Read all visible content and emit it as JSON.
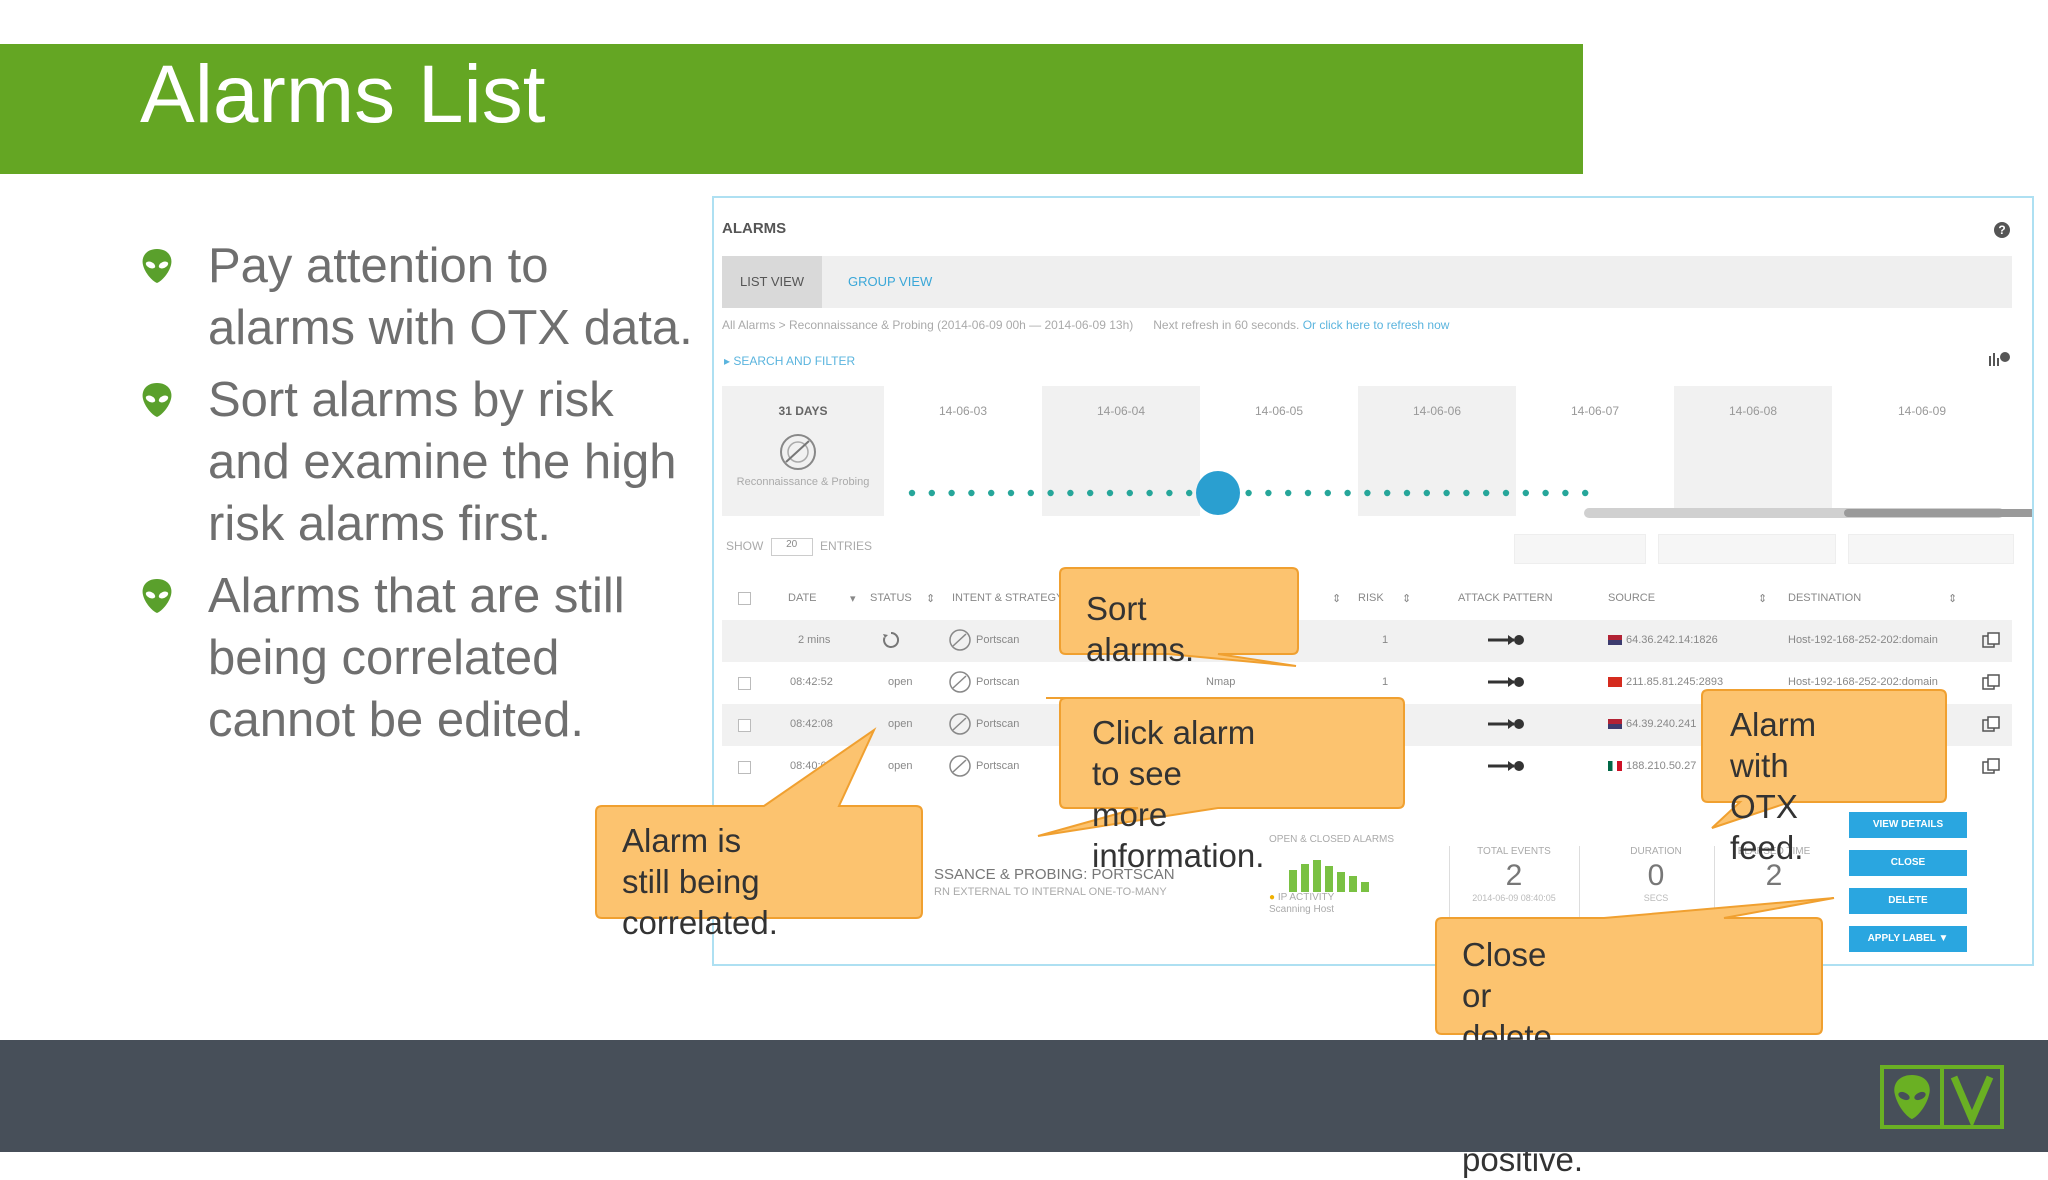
{
  "slide": {
    "title": "Alarms List",
    "bullets": [
      "Pay attention to alarms with OTX data.",
      "Sort alarms by risk and examine the high risk alarms first.",
      "Alarms that are still being correlated cannot be edited."
    ]
  },
  "screenshot": {
    "panel_title": "ALARMS",
    "help_glyph": "?",
    "tabs": [
      "LIST VIEW",
      "GROUP VIEW"
    ],
    "breadcrumb": "All Alarms > Reconnaissance & Probing (2014-06-09 00h — 2014-06-09 13h)",
    "refresh_text": "Next refresh in 60 seconds.",
    "refresh_link": "Or click here to refresh now",
    "search_filter": "▸ SEARCH AND FILTER",
    "timeline": {
      "range_label": "31 DAYS",
      "dates": [
        "14-06-03",
        "14-06-04",
        "14-06-05",
        "14-06-06",
        "14-06-07",
        "14-06-08",
        "14-06-09"
      ],
      "category_label": "Reconnaissance & Probing"
    },
    "show_label": "SHOW",
    "show_value": "20",
    "entries_label": "ENTRIES",
    "columns": [
      "DATE",
      "STATUS",
      "INTENT & STRATEGY",
      "RISK",
      "ATTACK PATTERN",
      "SOURCE",
      "DESTINATION"
    ],
    "rows": [
      {
        "date": "2 mins",
        "status": "",
        "intent": "Portscan",
        "method": "",
        "risk": "1",
        "source": "64.36.242.14:1826",
        "destination": "Host-192-168-252-202:domain"
      },
      {
        "date": "08:42:52",
        "status": "open",
        "intent": "Portscan",
        "method": "Nmap",
        "risk": "1",
        "source": "211.85.81.245:2893",
        "destination": "Host-192-168-252-202:domain"
      },
      {
        "date": "08:42:08",
        "status": "open",
        "intent": "Portscan",
        "method": "",
        "risk": "",
        "source": "64.39.240.241",
        "destination": ""
      },
      {
        "date": "08:40:0",
        "status": "open",
        "intent": "Portscan",
        "method": "",
        "risk": "",
        "source": "188.210.50.27",
        "destination": ""
      }
    ],
    "detail": {
      "title": "SSANCE & PROBING: PORTSCAN",
      "subtitle": "RN  EXTERNAL TO INTERNAL ONE-TO-MANY",
      "open_closed_label": "OPEN & CLOSED ALARMS",
      "ip_activity_label": "IP ACTIVITY",
      "ip_activity_value": "Scanning Host",
      "stats": [
        {
          "label": "TOTAL EVENTS",
          "value": "2",
          "sub": "2014-06-09 08:40:05"
        },
        {
          "label": "DURATION",
          "value": "0",
          "sub": "SECS"
        },
        {
          "label": "ELAPSED TIME",
          "value": "2",
          "sub": ""
        }
      ],
      "buttons": [
        "VIEW DETAILS",
        "CLOSE",
        "DELETE",
        "APPLY LABEL ▼"
      ]
    }
  },
  "callouts": {
    "sort": "Sort alarms.",
    "click_line1": "Click alarm to see",
    "click_line2": "more information.",
    "otx_line1": "Alarm with",
    "otx_line2": "OTX feed.",
    "correlated_line1": "Alarm is still being",
    "correlated_line2": "correlated.",
    "close_line1": "Close or delete alarm",
    "close_line2": "if false positive."
  },
  "colors": {
    "title_bar": "#64a623",
    "footer": "#474f59",
    "callout_fill": "#fcc36f",
    "callout_stroke": "#f0a030",
    "action_button": "#2aa6e0",
    "timeline_dot": "#26a69a"
  },
  "icons": {
    "bullet": "alien-head-icon",
    "logo": "alienvault-logo-icon"
  }
}
